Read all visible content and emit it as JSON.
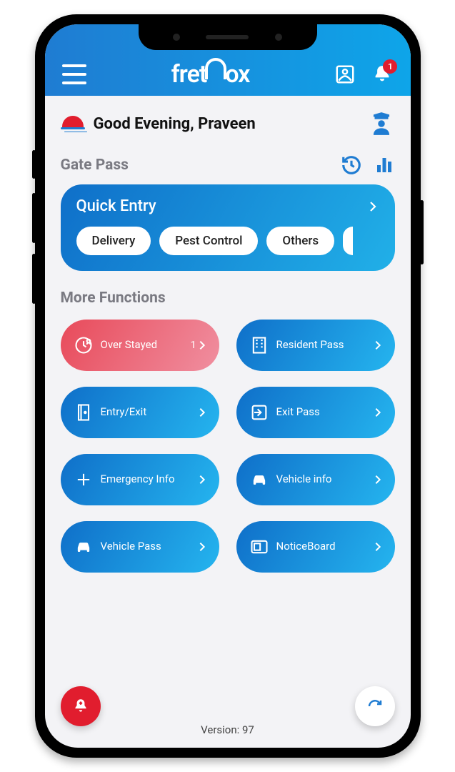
{
  "header": {
    "logo_text_left": "fret",
    "logo_text_right": "ox",
    "notification_count": "1"
  },
  "greeting": {
    "text": "Good Evening, Praveen"
  },
  "gate_pass": {
    "title": "Gate Pass"
  },
  "quick_entry": {
    "title": "Quick Entry",
    "chips": [
      "Delivery",
      "Pest Control",
      "Others"
    ]
  },
  "more_functions": {
    "title": "More Functions",
    "items": [
      {
        "label": "Over Stayed",
        "badge": "1",
        "icon": "clock-person",
        "variant": "red"
      },
      {
        "label": "Resident Pass",
        "icon": "building",
        "variant": "blue"
      },
      {
        "label": "Entry/Exit",
        "icon": "door",
        "variant": "blue"
      },
      {
        "label": "Exit Pass",
        "icon": "exit-arrow",
        "variant": "blue"
      },
      {
        "label": "Emergency Info",
        "icon": "plus",
        "variant": "blue"
      },
      {
        "label": "Vehicle info",
        "icon": "car",
        "variant": "blue"
      },
      {
        "label": "Vehicle Pass",
        "icon": "car",
        "variant": "blue"
      },
      {
        "label": "NoticeBoard",
        "icon": "noticeboard",
        "variant": "blue"
      }
    ]
  },
  "footer": {
    "version_label": "Version: 97"
  }
}
